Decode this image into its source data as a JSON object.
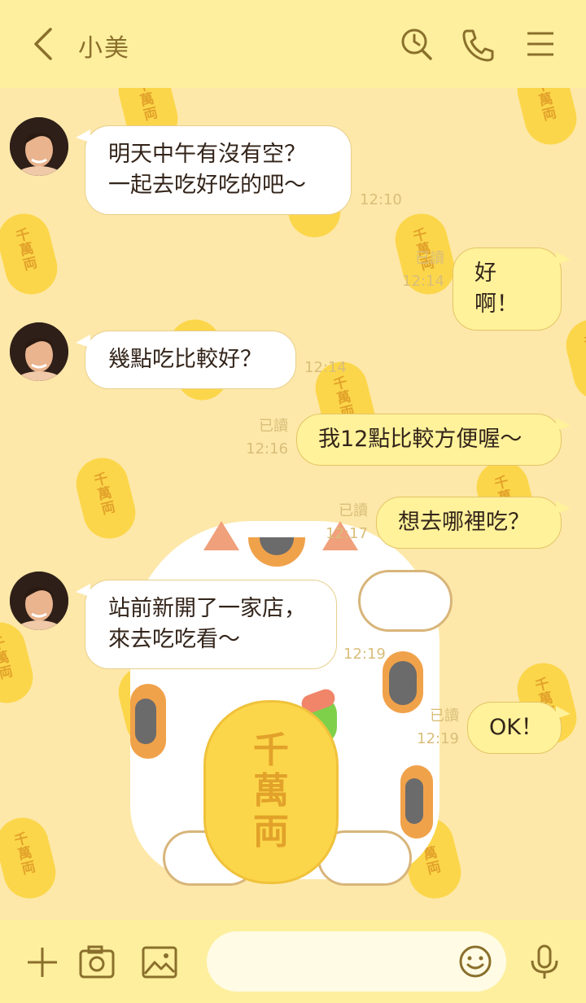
{
  "header": {
    "contact_name": "小美",
    "icons": [
      "back-chevron-icon",
      "search-icon",
      "phone-icon",
      "menu-icon"
    ]
  },
  "background": {
    "coin_text": "千\n萬\n両",
    "big_coin_text": "千\n萬\n両"
  },
  "messages": [
    {
      "side": "in",
      "text": "明天中午有沒有空？\n一起去吃好吃的吧～",
      "time": "12:10"
    },
    {
      "side": "out",
      "text": "好啊！",
      "read": "已讀",
      "time": "12:14"
    },
    {
      "side": "in",
      "text": "幾點吃比較好？",
      "time": "12:14"
    },
    {
      "side": "out",
      "text": "我12點比較方便喔～",
      "read": "已讀",
      "time": "12:16"
    },
    {
      "side": "out",
      "text": "想去哪裡吃？",
      "read": "已讀",
      "time": "12:17"
    },
    {
      "side": "in",
      "text": "站前新開了一家店，\n來去吃吃看～",
      "time": "12:19"
    },
    {
      "side": "out",
      "text": "OK！",
      "read": "已讀",
      "time": "12:19"
    }
  ],
  "footer": {
    "input_value": "",
    "input_placeholder": "",
    "icons": [
      "plus-icon",
      "camera-icon",
      "image-icon",
      "emoji-icon",
      "microphone-icon"
    ]
  },
  "colors": {
    "header_bg": "#fdef9e",
    "chat_bg": "#fde8a9",
    "outgoing_bubble": "#fff29a",
    "incoming_bubble": "#ffffff",
    "icon_color": "#8a6f2c"
  }
}
